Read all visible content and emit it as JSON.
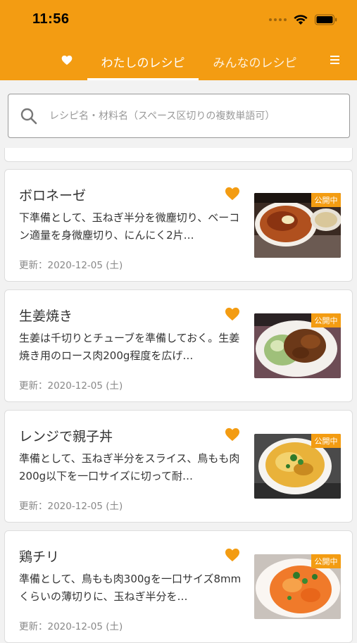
{
  "status": {
    "time": "11:56"
  },
  "tabs": {
    "mine": "わたしのレシピ",
    "everyone": "みんなのレシピ"
  },
  "search": {
    "placeholder": "レシピ名・材料名（スペース区切りの複数単語可）"
  },
  "colors": {
    "accent": "#f39c12",
    "favorite": "#f39c12"
  },
  "recipes": [
    {
      "title": "ボロネーゼ",
      "desc": "下準備として、玉ねぎ半分を微塵切り、ベーコン適量を身微塵切り、にんにく2片…",
      "date": "更新：2020-12-05 (土)",
      "badge": "公開中",
      "favorite": true
    },
    {
      "title": "生姜焼き",
      "desc": "生姜は千切りとチューブを準備しておく。生姜焼き用のロース肉200g程度を広げ…",
      "date": "更新：2020-12-05 (土)",
      "badge": "公開中",
      "favorite": true
    },
    {
      "title": "レンジで親子丼",
      "desc": "準備として、玉ねぎ半分をスライス、鳥もも肉200g以下を一口サイズに切って耐…",
      "date": "更新：2020-12-05 (土)",
      "badge": "公開中",
      "favorite": true
    },
    {
      "title": "鶏チリ",
      "desc": "準備として、鳥もも肉300gを一口サイズ8mmくらいの薄切りに、玉ねぎ半分を…",
      "date": "更新：2020-12-05 (土)",
      "badge": "公開中",
      "favorite": true
    }
  ]
}
